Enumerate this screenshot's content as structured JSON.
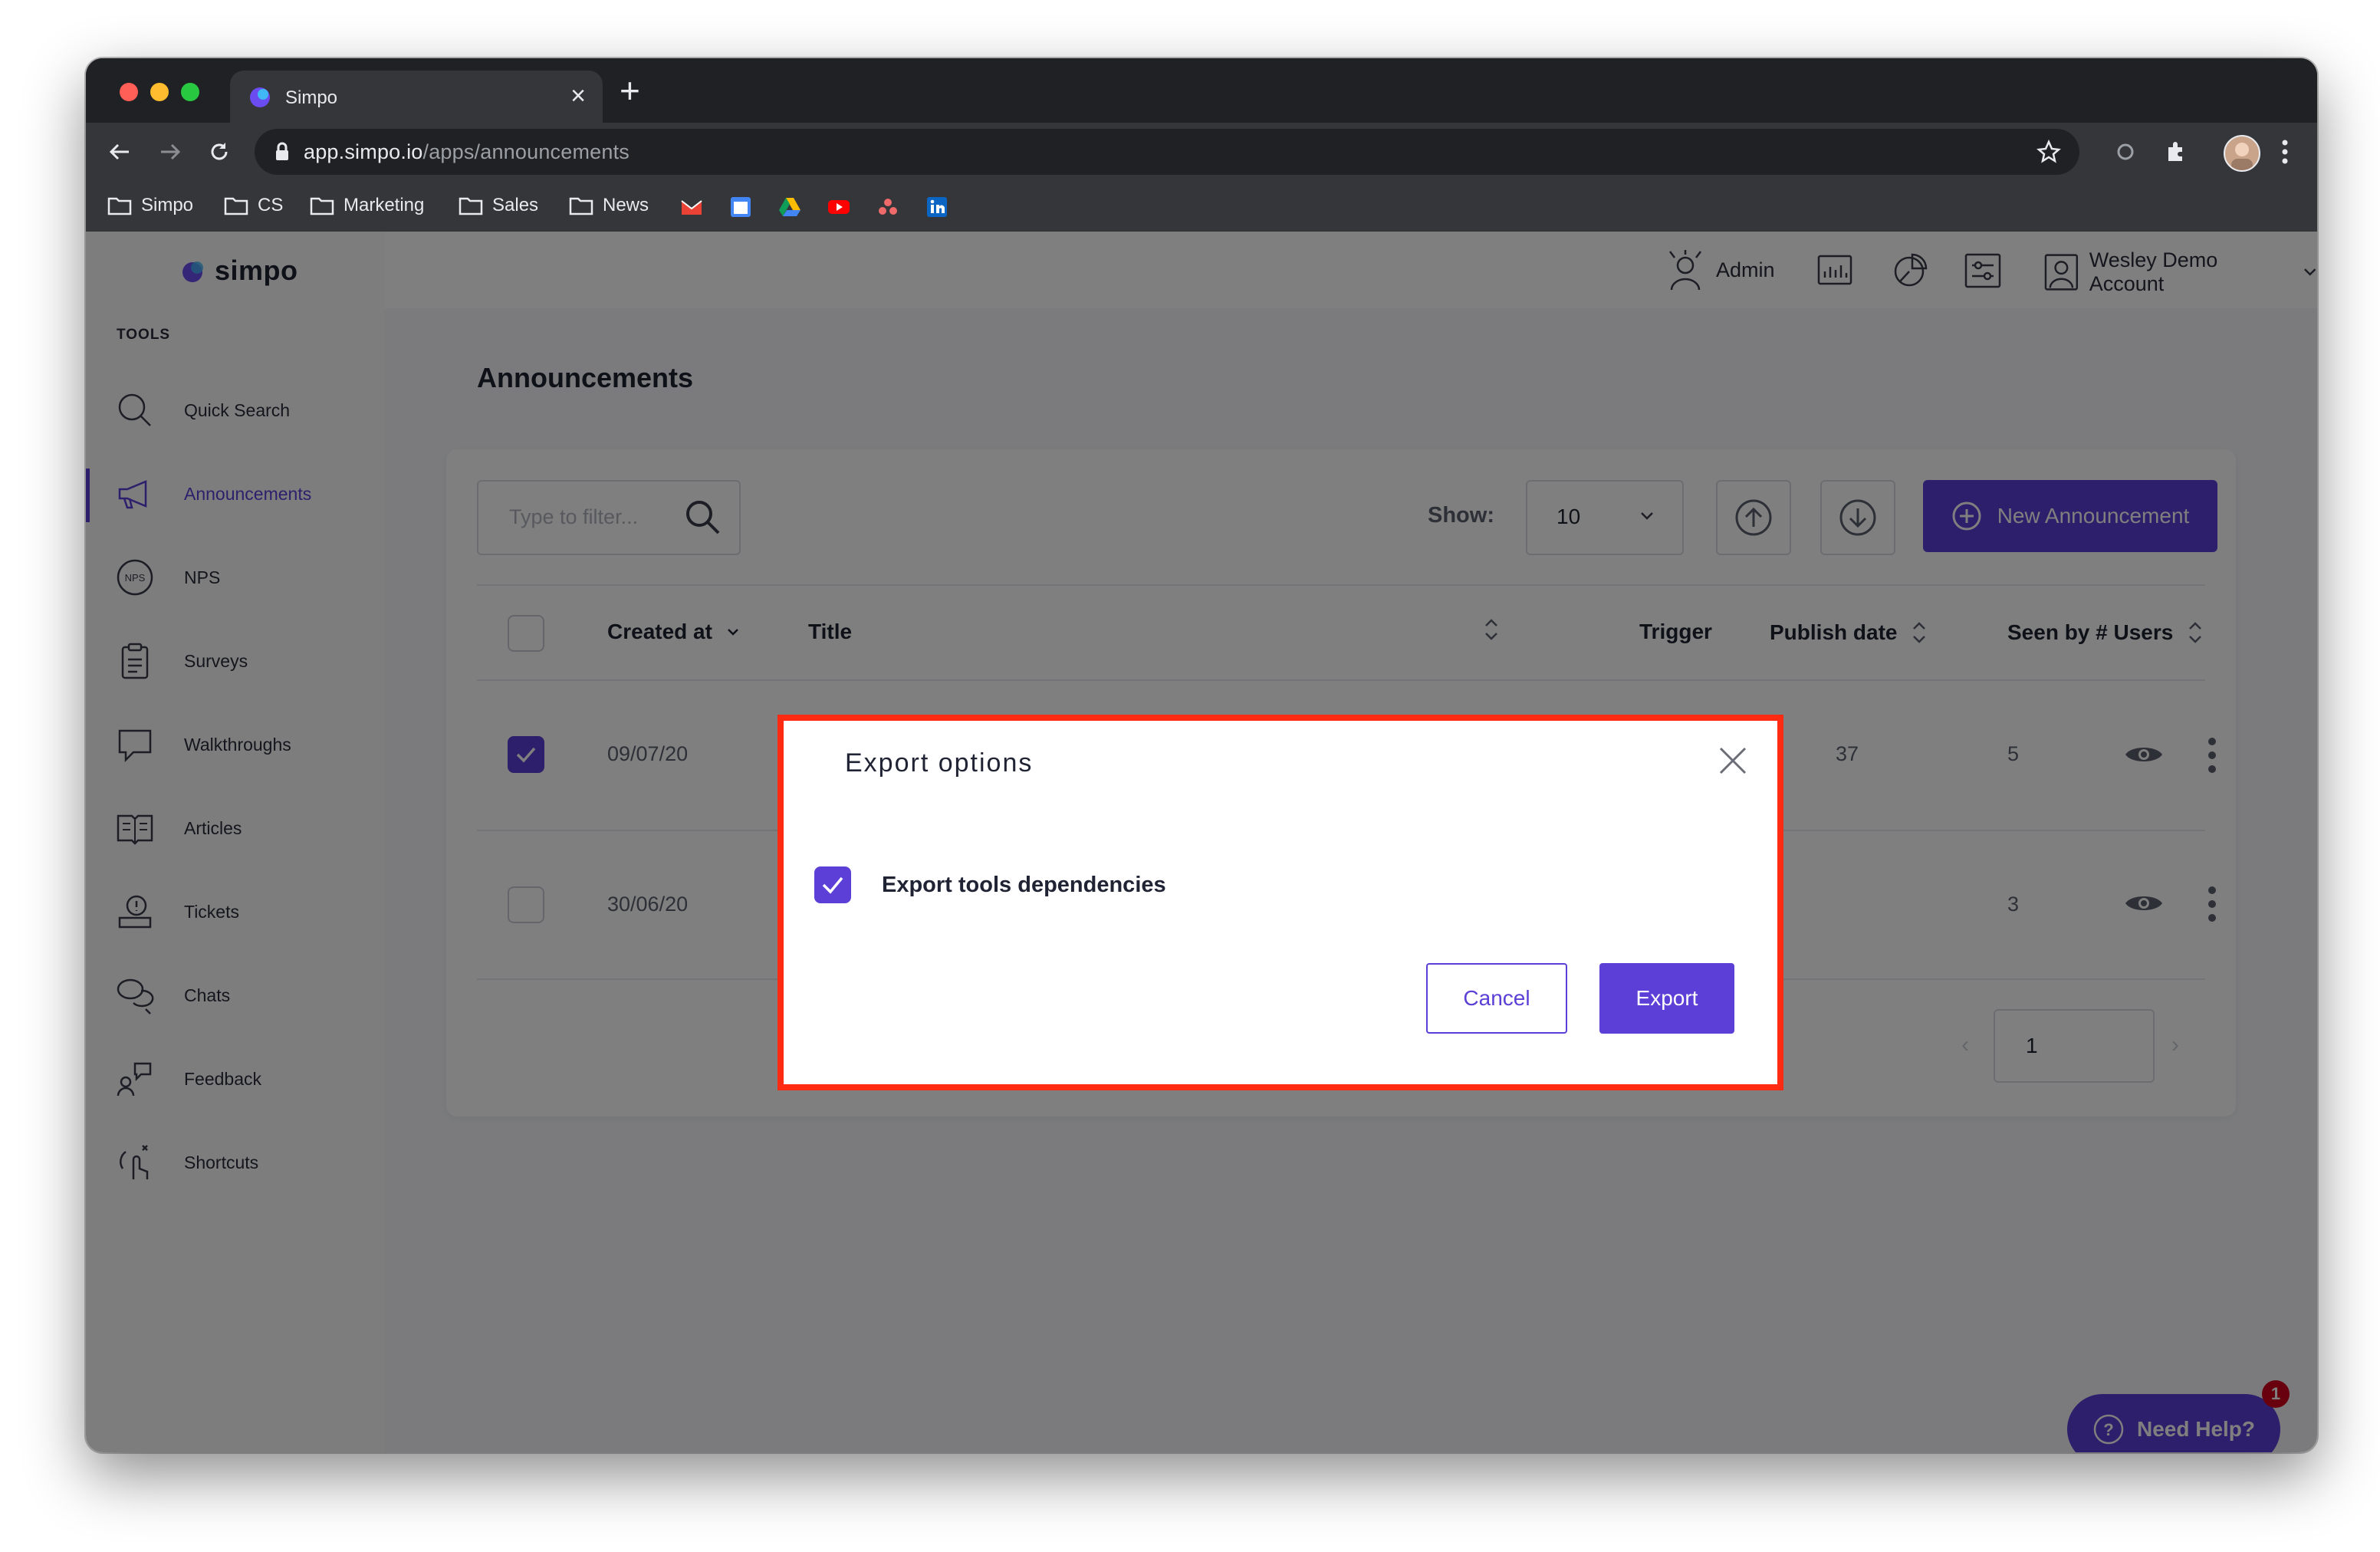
{
  "browser": {
    "tab_title": "Simpo",
    "url_host": "app.simpo.io",
    "url_path": "/apps/announcements",
    "bookmarks": [
      "Simpo",
      "CS",
      "Marketing",
      "Sales",
      "News"
    ]
  },
  "app": {
    "brand": "simpo",
    "sidebar_section": "TOOLS",
    "sidebar_items": [
      "Quick Search",
      "Announcements",
      "NPS",
      "Surveys",
      "Walkthroughs",
      "Articles",
      "Tickets",
      "Chats",
      "Feedback",
      "Shortcuts"
    ],
    "active_item": "Announcements",
    "topbar": {
      "admin_label": "Admin",
      "account_name": "Wesley Demo Account"
    },
    "page_title": "Announcements",
    "filter_placeholder": "Type to filter...",
    "show_label": "Show:",
    "page_size": "10",
    "new_button": "New Announcement",
    "columns": [
      "Created at",
      "Title",
      "Trigger",
      "Publish date",
      "Seen by # Users"
    ],
    "rows": [
      {
        "created_at": "09/07/20",
        "publish_tail": "37",
        "seen_by": "5",
        "checked": true
      },
      {
        "created_at": "30/06/20",
        "publish_tail": "",
        "seen_by": "3",
        "checked": false
      }
    ],
    "current_page": "1",
    "help_label": "Need Help?",
    "help_badge": "1"
  },
  "modal": {
    "title": "Export options",
    "checkbox_label": "Export tools dependencies",
    "checkbox_checked": true,
    "cancel_label": "Cancel",
    "export_label": "Export",
    "highlight_color": "#ff2a12"
  },
  "colors": {
    "accent": "#5b3fd6",
    "chrome_dark": "#202124",
    "chrome_tab": "#35363a"
  }
}
